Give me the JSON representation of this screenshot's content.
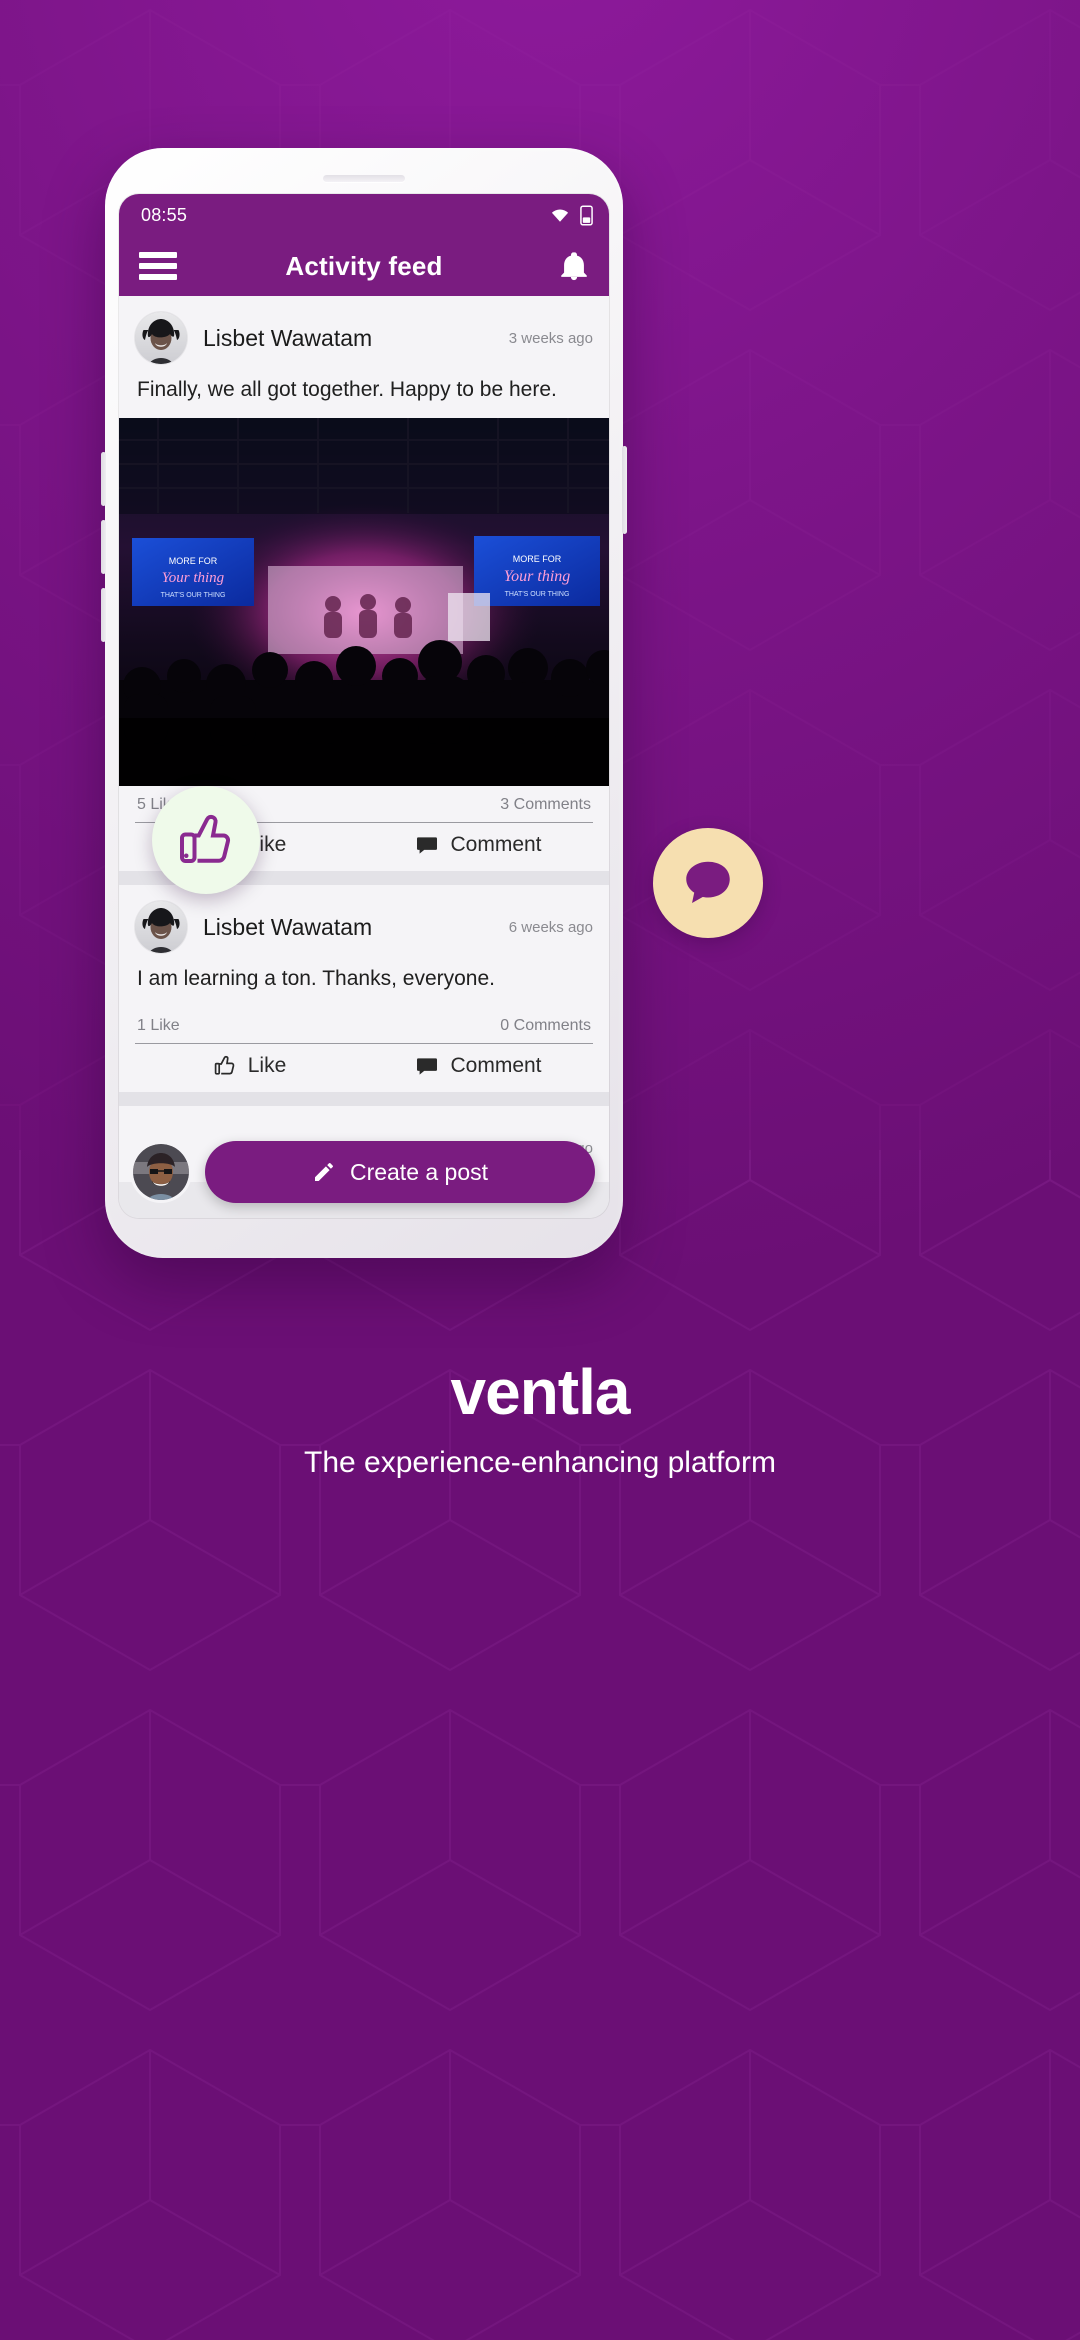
{
  "theme": {
    "brand_purple": "#7a1c80",
    "background_purple": "#7d1589",
    "badge_like_bg": "#effaea",
    "badge_comment_bg": "#f6dfb0"
  },
  "statusbar": {
    "clock": "08:55",
    "icons": [
      "wifi-icon",
      "battery-icon"
    ]
  },
  "appbar": {
    "menu_icon": "hamburger-menu-icon",
    "title": "Activity feed",
    "notifications_icon": "bell-icon"
  },
  "floating_badges": {
    "like": "thumbs-up-icon",
    "comment": "comment-bubble-icon"
  },
  "feed": {
    "posts": [
      {
        "author": "Lisbet Wawatam",
        "timeago": "3 weeks ago",
        "text": "Finally, we all got together. Happy to be here.",
        "has_image": true,
        "likes": "5 Likes",
        "comments": "3 Comments",
        "like_label": "Like",
        "comment_label": "Comment"
      },
      {
        "author": "Lisbet Wawatam",
        "timeago": "6 weeks ago",
        "text": "I am learning a ton. Thanks, everyone.",
        "has_image": false,
        "likes": "1 Like",
        "comments": "0 Comments",
        "like_label": "Like",
        "comment_label": "Comment"
      }
    ],
    "partial_post_timeago": "eks ago"
  },
  "composer": {
    "button_label": "Create a post",
    "button_icon": "pencil-icon"
  },
  "branding": {
    "logo": "ventla",
    "tagline": "The experience-enhancing platform"
  }
}
